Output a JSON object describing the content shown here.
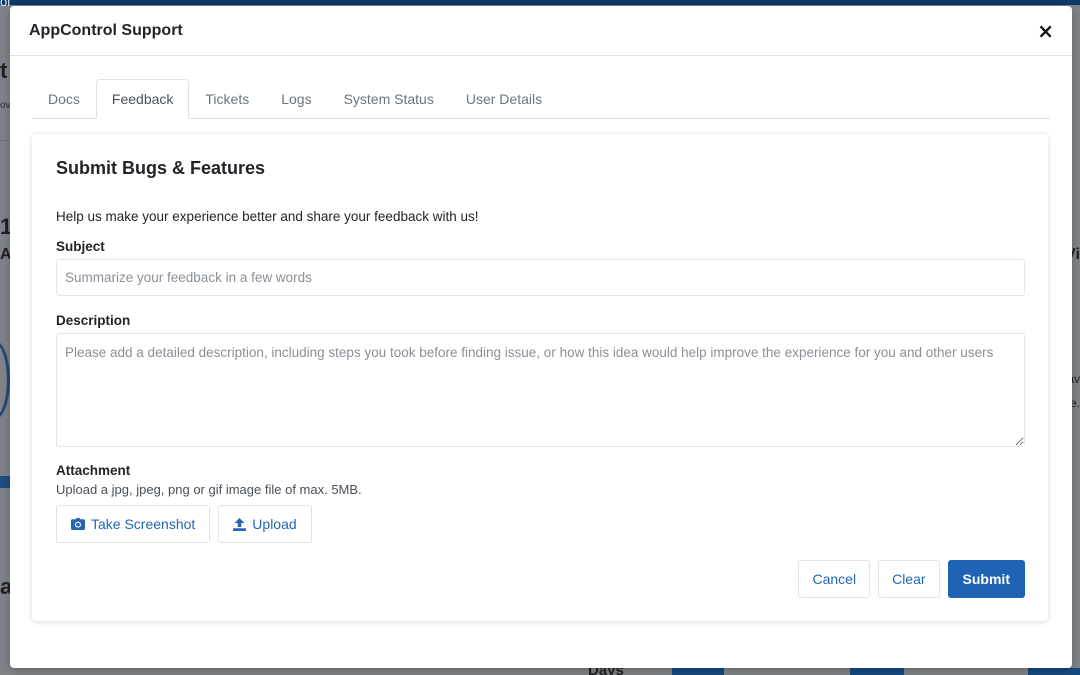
{
  "background": {
    "topbar_fragment": "ol",
    "frag_t": "t",
    "frag_ov": "ov",
    "frag_1": "1",
    "frag_A": "A",
    "frag_a": "a",
    "frag_vi": "Vi",
    "frag_av": "av",
    "frag_e": "e.",
    "frag_days": "Days",
    "frag_comma": ","
  },
  "modal": {
    "title": "AppControl Support",
    "close_label": "×"
  },
  "tabs": [
    {
      "label": "Docs",
      "active": false
    },
    {
      "label": "Feedback",
      "active": true
    },
    {
      "label": "Tickets",
      "active": false
    },
    {
      "label": "Logs",
      "active": false
    },
    {
      "label": "System Status",
      "active": false
    },
    {
      "label": "User Details",
      "active": false
    }
  ],
  "form": {
    "title": "Submit Bugs & Features",
    "intro": "Help us make your experience better and share your feedback with us!",
    "subject_label": "Subject",
    "subject_value": "",
    "subject_placeholder": "Summarize your feedback in a few words",
    "description_label": "Description",
    "description_value": "",
    "description_placeholder": "Please add a detailed description, including steps you took before finding issue, or how this idea would help improve the experience for you and other users",
    "attachment_label": "Attachment",
    "attachment_hint": "Upload a jpg, jpeg, png or gif image file of max. 5MB.",
    "screenshot_label": "Take Screenshot",
    "upload_label": "Upload"
  },
  "actions": {
    "cancel_label": "Cancel",
    "clear_label": "Clear",
    "submit_label": "Submit"
  },
  "icons": {
    "screenshot": "camera-icon",
    "upload": "upload-icon",
    "close": "close-icon"
  },
  "colors": {
    "accent": "#1f63b5",
    "link": "#2566b0",
    "backdrop": "#808488"
  }
}
